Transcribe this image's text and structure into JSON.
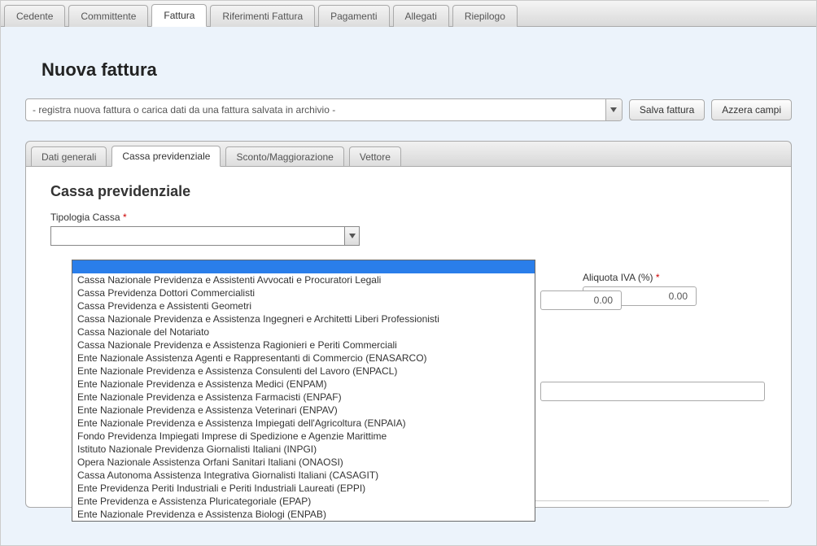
{
  "mainTabs": {
    "items": [
      {
        "label": "Cedente"
      },
      {
        "label": "Committente"
      },
      {
        "label": "Fattura"
      },
      {
        "label": "Riferimenti Fattura"
      },
      {
        "label": "Pagamenti"
      },
      {
        "label": "Allegati"
      },
      {
        "label": "Riepilogo"
      }
    ],
    "activeIndex": 2
  },
  "pageTitle": "Nuova fattura",
  "archiveCombo": {
    "placeholder": "- registra nuova fattura o carica dati da una fattura salvata in archivio -"
  },
  "buttons": {
    "save": "Salva fattura",
    "reset": "Azzera campi"
  },
  "innerTabs": {
    "items": [
      {
        "label": "Dati generali"
      },
      {
        "label": "Cassa previdenziale"
      },
      {
        "label": "Sconto/Maggiorazione"
      },
      {
        "label": "Vettore"
      }
    ],
    "activeIndex": 1
  },
  "section": {
    "title": "Cassa previdenziale",
    "field_tipologia_label": "Tipologia Cassa",
    "field_aliquota_label": "Aliquota IVA (%)",
    "aliquota_value": "0.00",
    "other_numeric_value": "0.00"
  },
  "dropdown": {
    "selectedIndex": 0,
    "options": [
      "",
      "Cassa Nazionale Previdenza e Assistenti Avvocati e Procuratori Legali",
      "Cassa Previdenza Dottori Commercialisti",
      "Cassa Previdenza e Assistenti Geometri",
      "Cassa Nazionale Previdenza e Assistenza Ingegneri e Architetti Liberi Professionisti",
      "Cassa Nazionale del Notariato",
      "Cassa Nazionale Previdenza e Assistenza Ragionieri e Periti Commerciali",
      "Ente Nazionale Assistenza Agenti e Rappresentanti di Commercio (ENASARCO)",
      "Ente Nazionale Previdenza e Assistenza Consulenti del Lavoro (ENPACL)",
      "Ente Nazionale Previdenza e Assistenza Medici (ENPAM)",
      "Ente Nazionale Previdenza e Assistenza Farmacisti (ENPAF)",
      "Ente Nazionale Previdenza e Assistenza Veterinari (ENPAV)",
      "Ente Nazionale Previdenza e Assistenza Impiegati dell'Agricoltura (ENPAIA)",
      "Fondo Previdenza Impiegati Imprese di Spedizione e Agenzie Marittime",
      "Istituto Nazionale Previdenza Giornalisti Italiani (INPGI)",
      "Opera Nazionale Assistenza Orfani Sanitari Italiani (ONAOSI)",
      "Cassa Autonoma Assistenza Integrativa Giornalisti Italiani (CASAGIT)",
      "Ente Previdenza Periti Industriali e Periti Industriali Laureati (EPPI)",
      "Ente Previdenza e Assistenza Pluricategoriale (EPAP)",
      "Ente Nazionale Previdenza e Assistenza Biologi (ENPAB)"
    ]
  }
}
